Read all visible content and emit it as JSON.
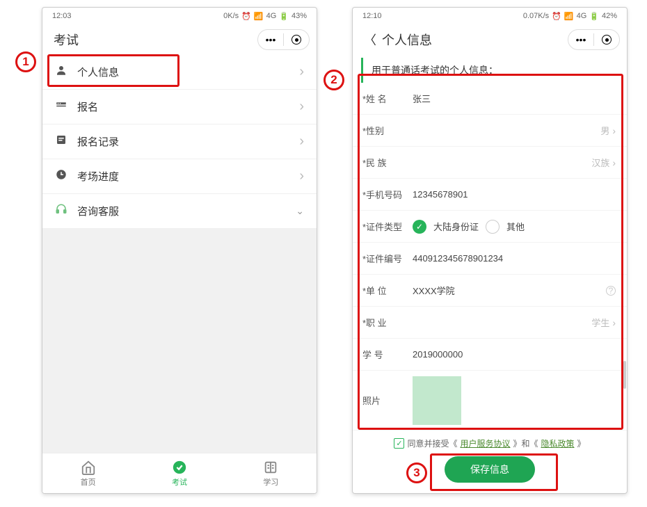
{
  "annotations": {
    "c1": "1",
    "c2": "2",
    "c3": "3"
  },
  "left": {
    "status": {
      "time": "12:03",
      "speed": "0K/s",
      "net": "4G",
      "battery": "43%"
    },
    "header": {
      "title": "考试"
    },
    "capsule": {
      "more": "•••"
    },
    "menu": {
      "personal": "个人信息",
      "signup": "报名",
      "records": "报名记录",
      "progress": "考场进度",
      "support": "咨询客服"
    },
    "nav": {
      "home": "首页",
      "exam": "考试",
      "study": "学习"
    }
  },
  "right": {
    "status": {
      "time": "12:10",
      "speed": "0.07K/s",
      "net": "4G",
      "battery": "42%"
    },
    "header": {
      "title": "个人信息"
    },
    "capsule": {
      "more": "•••"
    },
    "subheader": "用于普通话考试的个人信息：",
    "fields": {
      "name_label": "*姓 名",
      "name_value": "张三",
      "gender_label": "*性别",
      "gender_value": "男",
      "ethnic_label": "*民 族",
      "ethnic_value": "汉族",
      "phone_label": "*手机号码",
      "phone_value": "12345678901",
      "idtype_label": "*证件类型",
      "idtype_opt1": "大陆身份证",
      "idtype_opt2": "其他",
      "idno_label": "*证件编号",
      "idno_value": "440912345678901234",
      "org_label": "*单 位",
      "org_value": "XXXX学院",
      "job_label": "*职 业",
      "job_value": "学生",
      "sid_label": "学 号",
      "sid_value": "2019000000",
      "photo_label": "照片"
    },
    "agree": {
      "text0": "同意并接受《",
      "link1": "用户服务协议",
      "mid": "》和《",
      "link2": "隐私政策",
      "text1": "》"
    },
    "save": "保存信息"
  }
}
